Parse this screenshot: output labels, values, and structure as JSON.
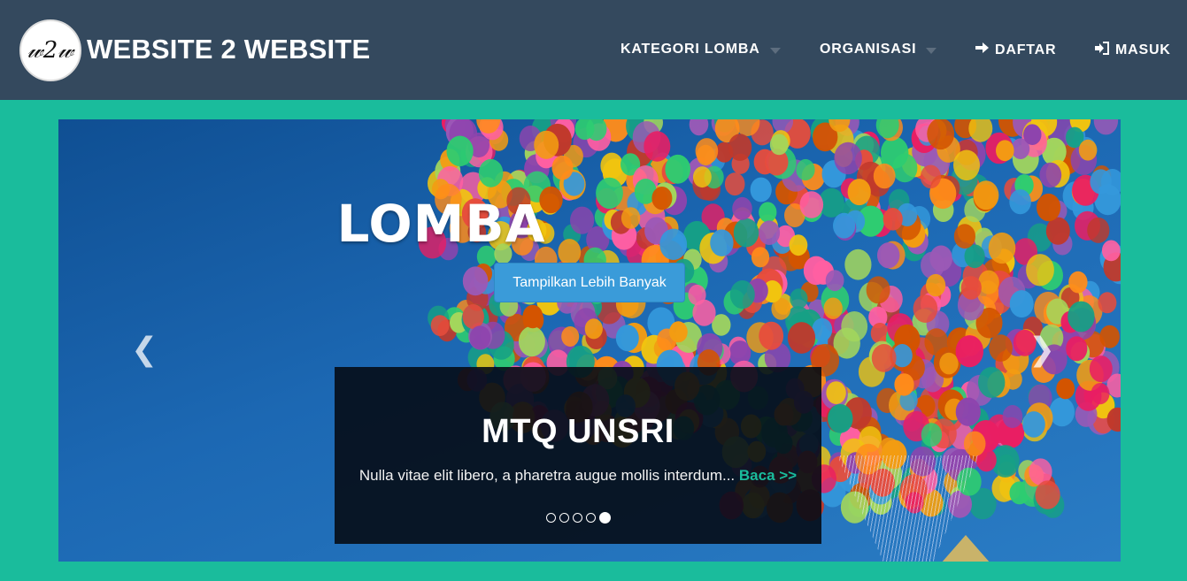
{
  "colors": {
    "nav_bg": "#34495e",
    "page_bg": "#1abc9c",
    "accent": "#1abc9c",
    "button": "#3a9bd9"
  },
  "navbar": {
    "logo_text": "W2W",
    "brand": "WEBSITE 2 WEBSITE",
    "items": [
      {
        "label": "KATEGORI LOMBA",
        "icon": "caret-down-icon"
      },
      {
        "label": "ORGANISASI",
        "icon": "caret-down-icon"
      },
      {
        "label": "DAFTAR",
        "icon": "arrow-right-icon"
      },
      {
        "label": "MASUK",
        "icon": "sign-in-icon"
      }
    ]
  },
  "carousel": {
    "hero_title": "LOMBA",
    "hero_button": "Tampilkan Lebih Banyak",
    "prev_icon": "chevron-left-icon",
    "next_icon": "chevron-right-icon",
    "caption": {
      "title": "MTQ UNSRI",
      "text": "Nulla vitae elit libero, a pharetra augue mollis interdum...",
      "read_more": "Baca >>"
    },
    "slide_count": 5,
    "active_slide": 5
  }
}
